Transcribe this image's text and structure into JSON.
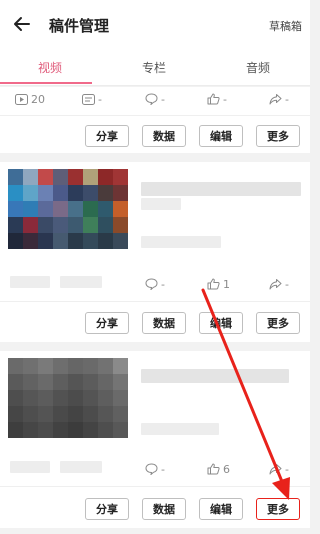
{
  "header": {
    "title": "稿件管理",
    "drafts_label": "草稿箱"
  },
  "tabs": [
    {
      "label": "视频",
      "active": true
    },
    {
      "label": "专栏",
      "active": false
    },
    {
      "label": "音频",
      "active": false
    }
  ],
  "cards": [
    {
      "stats": {
        "plays": "20",
        "danmaku": "-",
        "comments": "-",
        "likes": "-",
        "shares": "-"
      },
      "actions": {
        "share": "分享",
        "data": "数据",
        "edit": "编辑",
        "more": "更多"
      }
    },
    {
      "stats": {
        "comments": "-",
        "likes": "1",
        "shares": "-"
      },
      "actions": {
        "share": "分享",
        "data": "数据",
        "edit": "编辑",
        "more": "更多"
      }
    },
    {
      "stats": {
        "comments": "-",
        "likes": "6",
        "shares": "-"
      },
      "actions": {
        "share": "分享",
        "data": "数据",
        "edit": "编辑",
        "more": "更多"
      }
    }
  ],
  "colors": {
    "accent": "#e05a7a",
    "annotation_arrow": "#e8221b"
  },
  "icons": [
    "back-arrow-icon",
    "play-icon",
    "danmaku-icon",
    "comment-icon",
    "like-icon",
    "share-icon"
  ]
}
